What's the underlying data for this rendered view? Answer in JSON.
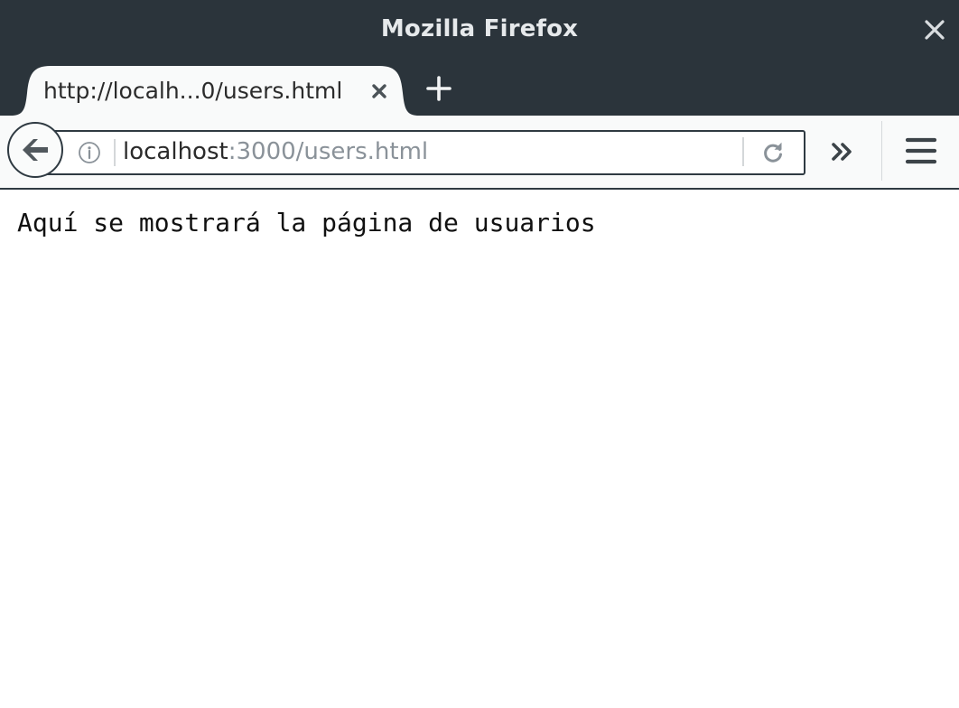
{
  "window": {
    "title": "Mozilla Firefox"
  },
  "tabs": [
    {
      "label": "http://localh...0/users.html",
      "active": true
    }
  ],
  "urlbar": {
    "host": "localhost",
    "path": ":3000/users.html"
  },
  "page": {
    "body_text": "Aquí se mostrará la página de usuarios"
  },
  "icons": {
    "window_close": "close-icon",
    "tab_close": "close-tab-icon",
    "new_tab": "plus-icon",
    "back": "back-arrow-icon",
    "site_info": "info-icon",
    "reload": "reload-icon",
    "overflow": "chevron-double-right-icon",
    "menu": "hamburger-menu-icon"
  },
  "colors": {
    "chrome_dark": "#2b343b",
    "toolbar": "#f9fafa",
    "url_path": "#8a9299"
  }
}
